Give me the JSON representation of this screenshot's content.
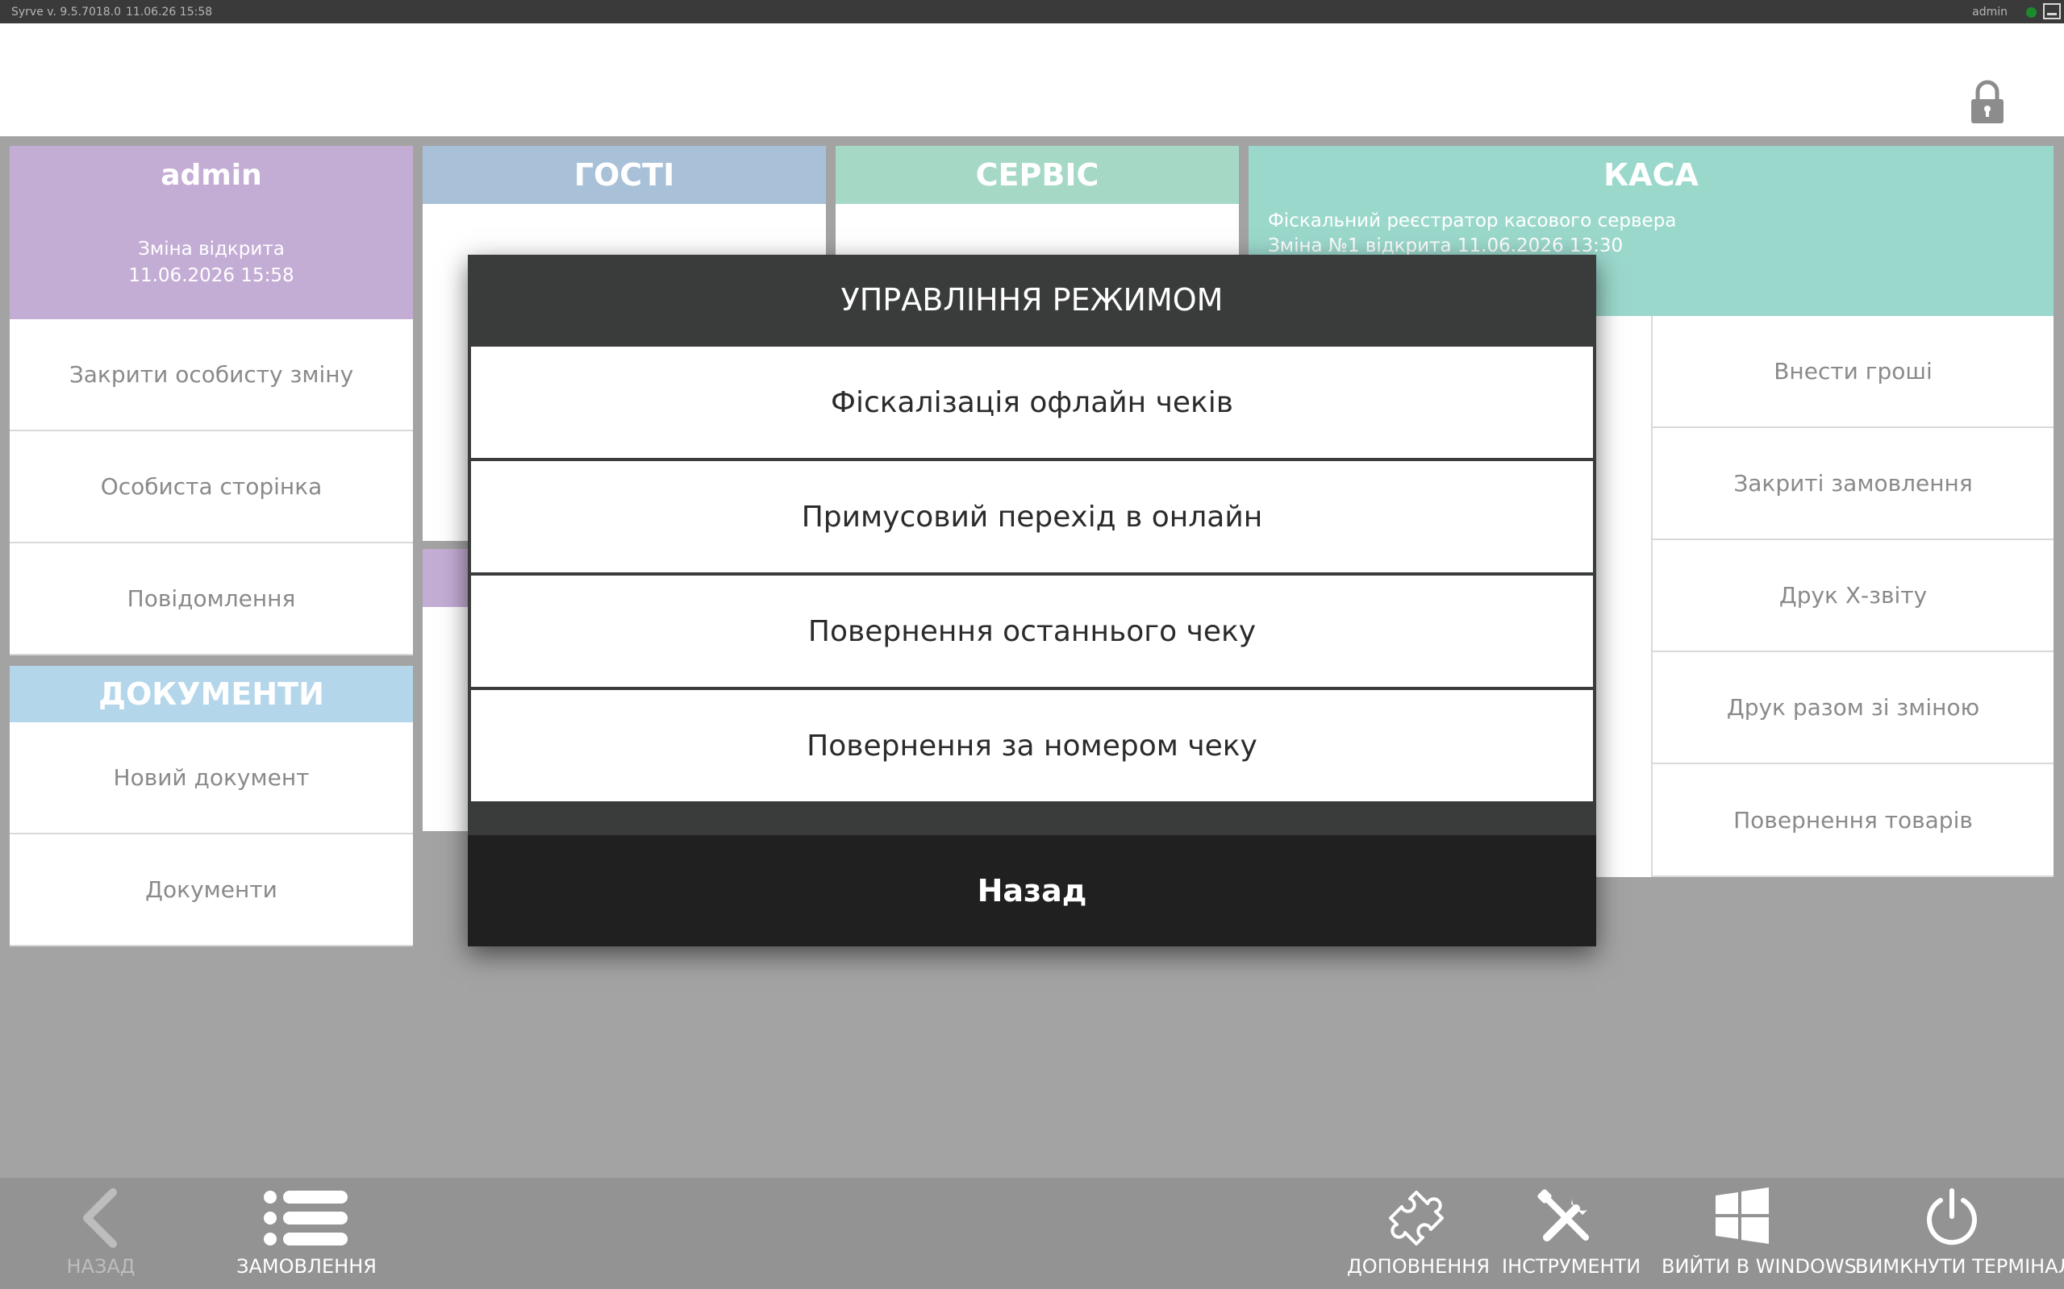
{
  "titlebar": {
    "version": "Syrve  v. 9.5.7018.0",
    "datetime": "11.06.26   15:58",
    "user": "admin"
  },
  "admin_panel": {
    "name": "admin",
    "shift_status": "Зміна відкрита",
    "shift_time": "11.06.2026 15:58",
    "items": [
      "Закрити особисту зміну",
      "Особиста сторінка",
      "Повідомлення"
    ]
  },
  "documents_panel": {
    "title": "ДОКУМЕНТИ",
    "items": [
      "Новий документ",
      "Документи"
    ]
  },
  "guests_panel": {
    "title": "ГОСТІ"
  },
  "service_panel": {
    "title": "СЕРВІС"
  },
  "kasa_panel": {
    "title": "КАСА",
    "line1": "Фіскальний реєстратор касового сервера",
    "line2": "Зміна №1 відкрита 11.06.2026 13:30",
    "items": [
      "Внести гроші",
      "Закриті замовлення",
      "Друк Х-звіту",
      "Друк разом зі зміною",
      "Повернення товарів"
    ]
  },
  "modal": {
    "title": "УПРАВЛІННЯ РЕЖИМОМ",
    "items": [
      "Фіскалізація офлайн чеків",
      "Примусовий перехід в онлайн",
      "Повернення останнього чеку",
      "Повернення за номером чеку"
    ],
    "back_label": "Назад"
  },
  "bottombar": {
    "back": "НАЗАД",
    "orders": "ЗАМОВЛЕННЯ",
    "addons": "ДОПОВНЕННЯ",
    "tools": "ІНСТРУМЕНТИ",
    "exit_windows": "ВИЙТИ В WINDOWS",
    "shutdown": "ВИМКНУТИ ТЕРМІНАЛ"
  },
  "icons": {
    "lock": "lock-icon",
    "back": "chevron-left-icon",
    "orders": "list-icon",
    "addons": "puzzle-icon",
    "tools": "tools-icon",
    "windows": "windows-icon",
    "power": "power-icon"
  }
}
